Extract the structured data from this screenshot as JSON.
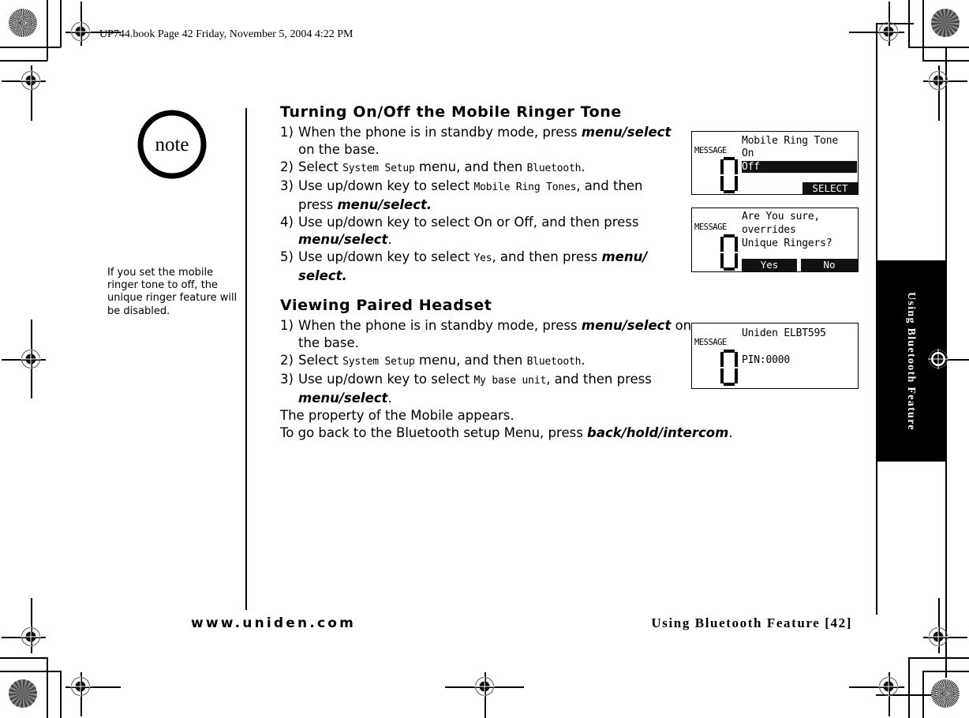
{
  "slug": "UP744.book  Page 42  Friday, November 5, 2004  4:22 PM",
  "note": {
    "icon_label": "note",
    "text": "If you set the mobile ringer tone to off, the unique ringer feature will be disabled."
  },
  "section1": {
    "title": "Turning On/Off the Mobile Ringer Tone",
    "steps": [
      {
        "num": "1)",
        "before": "When the phone is in standby mode, press ",
        "key": "menu/select",
        "after": " on the base."
      },
      {
        "num": "2)",
        "before": "Select ",
        "ui1": "System Setup",
        "mid": " menu, and then ",
        "ui2": "Bluetooth",
        "after": "."
      },
      {
        "num": "3)",
        "before": "Use up/down key to select ",
        "ui": "Mobile Ring Tones",
        "mid": ", and then press ",
        "key": "menu/select.",
        "after": ""
      },
      {
        "num": "4)",
        "before": "Use up/down key to select On or Off, and then press ",
        "key": "menu/select",
        "after": "."
      },
      {
        "num": "5)",
        "before": "Use up/down key to select ",
        "ui": "Yes",
        "mid": ", and then press ",
        "key": "menu/ select.",
        "after": ""
      }
    ]
  },
  "section2": {
    "title": "Viewing Paired Headset",
    "steps": [
      {
        "num": "1)",
        "before": "When the phone is in standby mode, press ",
        "key": "menu/select",
        "after": " on the base."
      },
      {
        "num": "2)",
        "before": "Select ",
        "ui1": "System Setup",
        "mid": " menu, and then ",
        "ui2": "Bluetooth",
        "after": "."
      },
      {
        "num": "3)",
        "before": "Use up/down key to select ",
        "ui": "My base unit",
        "mid": ", and then press ",
        "key": "menu/select",
        "after": "."
      }
    ],
    "outro1": "The property of the Mobile appears.",
    "outro2_before": "To go back to the Bluetooth setup Menu, press ",
    "outro2_key": "back/hold/intercom",
    "outro2_after": "."
  },
  "lcd_screens": [
    {
      "message_label": "MESSAGE",
      "lines": [
        "Mobile Ring Tone",
        "On",
        "Off"
      ],
      "highlighted_line": "Off",
      "softkeys": [
        "SELECT"
      ]
    },
    {
      "message_label": "MESSAGE",
      "lines": [
        "Are You sure,",
        "overrides",
        "Unique Ringers?"
      ],
      "softkeys": [
        "Yes",
        "No"
      ]
    },
    {
      "message_label": "MESSAGE",
      "lines": [
        "Uniden ELBT595",
        "PIN:0000"
      ],
      "softkeys": []
    }
  ],
  "side_tab": {
    "label": "Using Bluetooth Feature"
  },
  "footer": {
    "website": "www.uniden.com",
    "page_label": "Using Bluetooth Feature [42]"
  }
}
